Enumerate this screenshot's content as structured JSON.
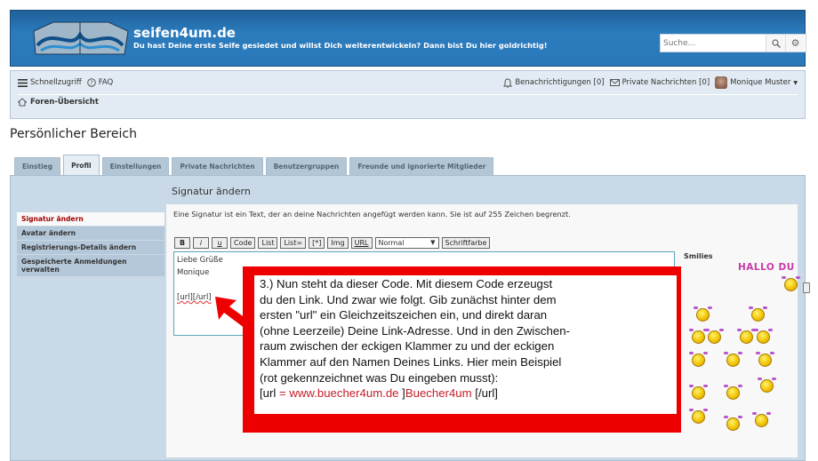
{
  "header": {
    "site_title": "seifen4um.de",
    "site_description": "Du hast Deine erste Seife gesiedet und willst Dich weiterentwickeln? Dann bist Du hier goldrichtig!",
    "search_placeholder": "Suche...",
    "search_icon": "magnifier-icon",
    "advanced_search_icon": "gear-icon"
  },
  "nav": {
    "quick_access": "Schnellzugriff",
    "faq": "FAQ",
    "notifications": "Benachrichtigungen [0]",
    "private_messages": "Private Nachrichten [0]",
    "username": "Monique Muster",
    "breadcrumb": "Foren-Übersicht"
  },
  "page_title": "Persönlicher Bereich",
  "tabs": [
    {
      "label": "Einstieg",
      "active": false
    },
    {
      "label": "Profil",
      "active": true
    },
    {
      "label": "Einstellungen",
      "active": false
    },
    {
      "label": "Private Nachrichten",
      "active": false
    },
    {
      "label": "Benutzergruppen",
      "active": false
    },
    {
      "label": "Freunde und ignorierte Mitglieder",
      "active": false
    }
  ],
  "side_menu": [
    {
      "label": "Signatur ändern",
      "active": true
    },
    {
      "label": "Avatar ändern",
      "active": false
    },
    {
      "label": "Registrierungs-Details ändern",
      "active": false
    },
    {
      "label": "Gespeicherte Anmeldungen verwalten",
      "active": false
    }
  ],
  "section": {
    "title": "Signatur ändern",
    "intro": "Eine Signatur ist ein Text, der an deine Nachrichten angefügt werden kann. Sie ist auf 255 Zeichen begrenzt."
  },
  "toolbar": {
    "buttons": [
      "B",
      "i",
      "u",
      "Code",
      "List",
      "List=",
      "[*]",
      "Img",
      "URL"
    ],
    "font_size_select": "Normal",
    "font_color": "Schriftfarbe"
  },
  "editor": {
    "lines": [
      "Liebe Grüße",
      "Monique",
      "",
      "[url][/url]"
    ]
  },
  "smilies": {
    "title": "Smilies",
    "banner": "HALLO DU"
  },
  "callout": {
    "lines": [
      "3.) Nun steht da dieser Code. Mit diesem Code erzeugst",
      "du den Link. Und zwar wie folgt. Gib zunächst hinter dem",
      "ersten \"url\" ein Gleichzeitszeichen ein, und direkt daran",
      "(ohne Leerzeile) Deine Link-Adresse. Und in den Zwischen-",
      "raum zwischen der eckigen Klammer zu und der eckigen",
      "Klammer auf den Namen Deines Links. Hier mein Beispiel",
      "(rot gekennzeichnet was Du eingeben musst):"
    ],
    "example": {
      "open": "[url",
      "equals": " = ",
      "address": "www.buecher4um.de",
      "close_bracket": " ]",
      "link_name": "Buecher4um",
      "end_tag": " [/url]"
    },
    "accent_color": "#ee0000"
  }
}
